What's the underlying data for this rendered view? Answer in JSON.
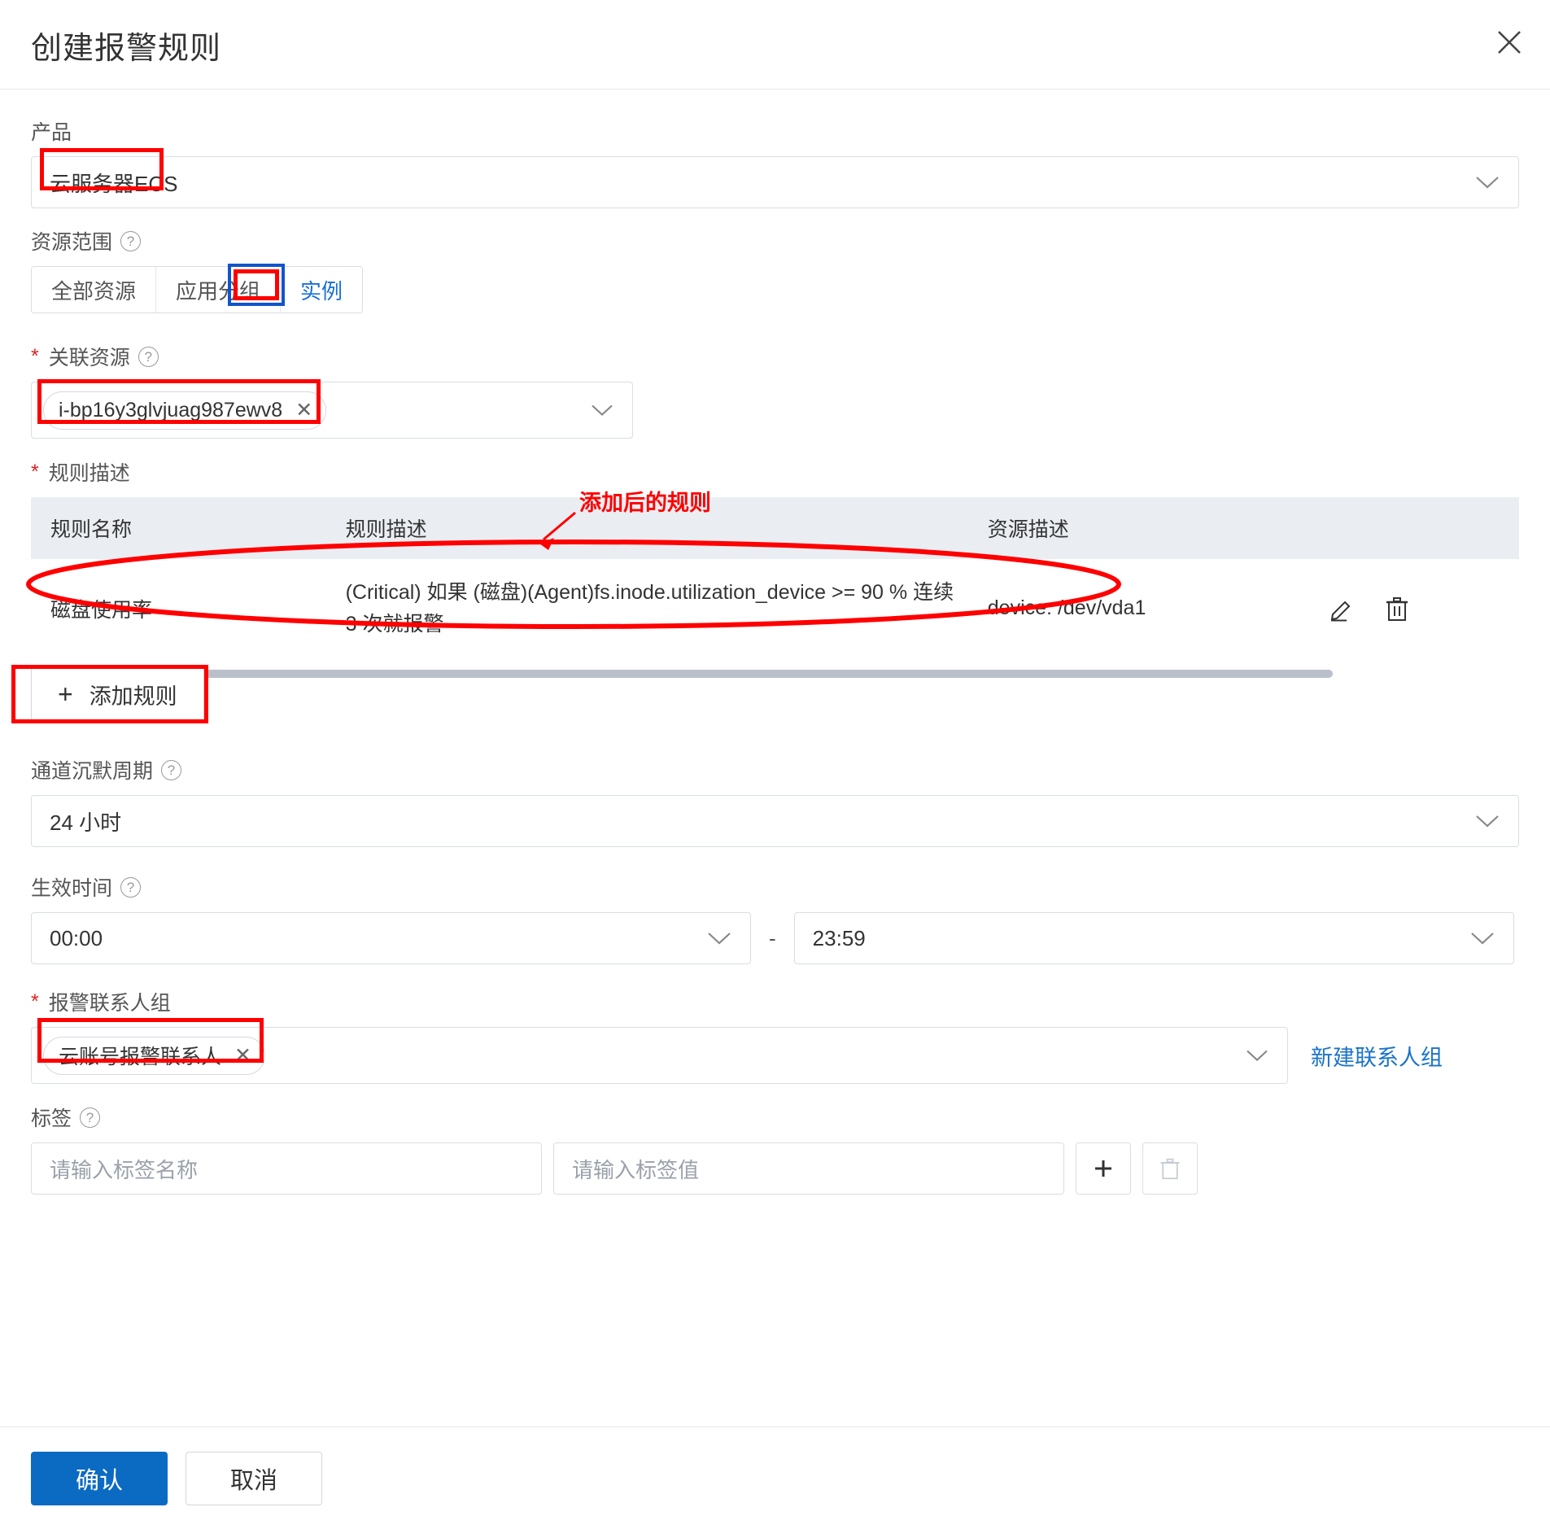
{
  "dialog": {
    "title": "创建报警规则",
    "close_icon": "close-icon"
  },
  "product": {
    "label": "产品",
    "value": "云服务器ECS"
  },
  "resource_scope": {
    "label": "资源范围",
    "help_icon": "question-circle-icon",
    "options": [
      "全部资源",
      "应用分组",
      "实例"
    ],
    "selected": "实例"
  },
  "associated_resource": {
    "label": "关联资源",
    "required": "*",
    "help_icon": "question-circle-icon",
    "chips": [
      {
        "text": "i-bp16y3glvjuag987ewv8",
        "remove_icon": "close-icon"
      }
    ]
  },
  "rule_description": {
    "label": "规则描述",
    "required": "*",
    "columns": [
      "规则名称",
      "规则描述",
      "资源描述"
    ],
    "rows": [
      {
        "name": "磁盘使用率",
        "description": "(Critical) 如果 (磁盘)(Agent)fs.inode.utilization_device >= 90 % 连续 3 次就报警",
        "resource": "device: /dev/vda1",
        "edit_icon": "pencil-icon",
        "delete_icon": "trash-icon"
      }
    ]
  },
  "add_rule_button": {
    "label": "添加规则",
    "icon": "plus-icon"
  },
  "silence_period": {
    "label": "通道沉默周期",
    "help_icon": "question-circle-icon",
    "value": "24 小时"
  },
  "effective_time": {
    "label": "生效时间",
    "help_icon": "question-circle-icon",
    "start": "00:00",
    "separator": "-",
    "end": "23:59"
  },
  "contact_group": {
    "label": "报警联系人组",
    "required": "*",
    "chips": [
      {
        "text": "云账号报警联系人",
        "remove_icon": "close-icon"
      }
    ],
    "new_group_link": "新建联系人组"
  },
  "tags": {
    "label": "标签",
    "help_icon": "question-circle-icon",
    "name_placeholder": "请输入标签名称",
    "value_placeholder": "请输入标签值",
    "add_icon": "plus-icon",
    "delete_icon": "trash-icon"
  },
  "footer": {
    "confirm_label": "确认",
    "cancel_label": "取消"
  },
  "annotations": {
    "callout_text": "添加后的规则",
    "highlight_color": "#ff0000",
    "selected_color": "#1155cc"
  }
}
